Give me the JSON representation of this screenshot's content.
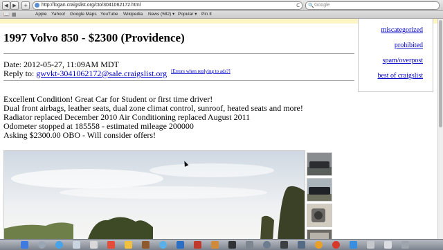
{
  "browser": {
    "url": "http://logan.craigslist.org/cto/3041062172.html",
    "search_placeholder": "Google",
    "nav": {
      "back": "◀",
      "forward": "▶",
      "add": "+",
      "reload": "C"
    },
    "bookmarks": [
      "Apple",
      "Yahoo!",
      "Google Maps",
      "YouTube",
      "Wikipedia",
      "News (582) ▾",
      "Popular ▾",
      "Pin It"
    ]
  },
  "posting": {
    "title": "1997 Volvo 850 - $2300 (Providence)",
    "date": "Date: 2012-05-27, 11:09AM MDT",
    "reply_label": "Reply to:",
    "reply_email": "gwvkt-3041062172@sale.craigslist.org",
    "errors_link": "[Errors when replying to ads?]",
    "body": [
      "Excellent Condition! Great Car for Student or first time driver!",
      "Dual front airbags, leather seats, dual zone climat control, sunroof, heated seats and more!",
      "Radiator replaced December 2010 Air Conditioning replaced August 2011",
      "Odometer stopped at 185558 - estimated mileage 200000",
      "Asking $2300.00 OBO - Will consider offers!"
    ]
  },
  "flags": [
    "miscategorized",
    "prohibited",
    "spam/overpost",
    "best of craigslist"
  ],
  "dock": {
    "icons": [
      "finder-icon",
      "launchpad-icon",
      "safari-icon",
      "mail-icon",
      "calendar-icon",
      "photos-icon",
      "itunes-icon",
      "app-store-icon",
      "terminal-icon",
      "preferences-icon",
      "chrome-icon",
      "firefox-icon",
      "trash-icon"
    ]
  },
  "colors": {
    "link": "#0000cc",
    "flagbox_border": "#c8c8c8"
  }
}
